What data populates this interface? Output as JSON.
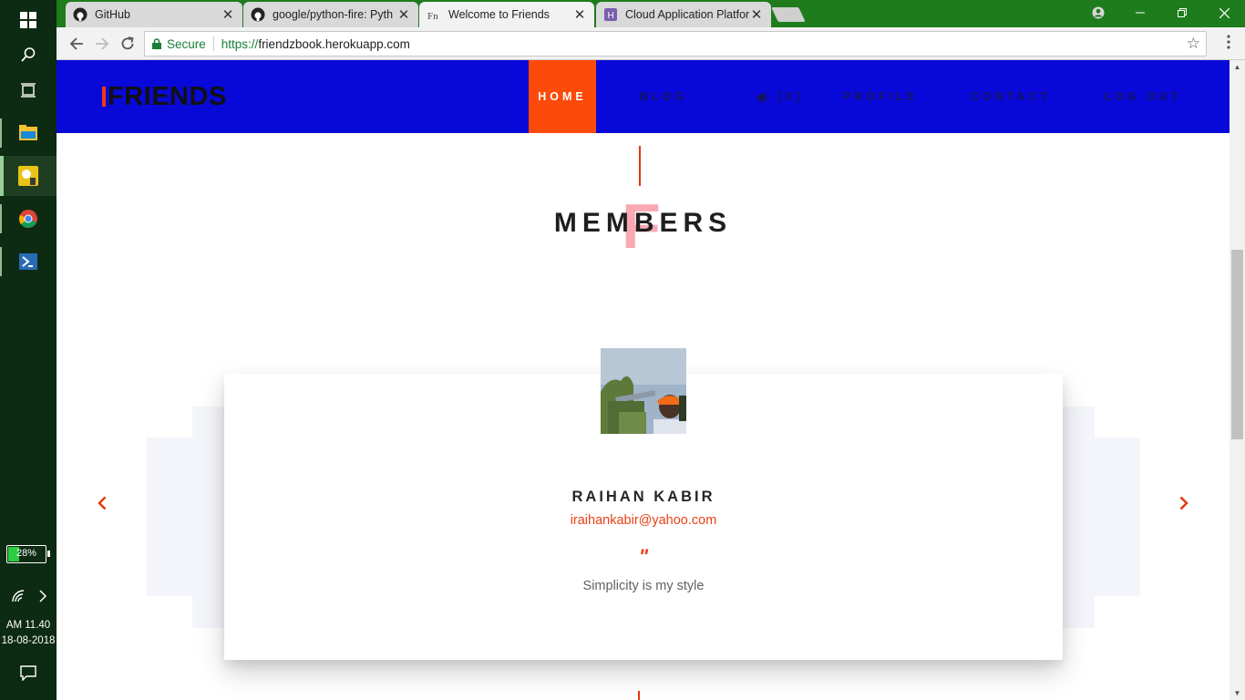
{
  "taskbar": {
    "clock_time": "AM 11.40",
    "clock_date": "18-08-2018",
    "battery_percent": "28%",
    "battery_level": 0.28
  },
  "browser": {
    "tabs": [
      {
        "title": "GitHub",
        "icon": "github-icon"
      },
      {
        "title": "google/python-fire: Pyth",
        "icon": "github-icon"
      },
      {
        "title": "Welcome to Friends",
        "icon": "friends-favicon"
      },
      {
        "title": "Cloud Application Platfor",
        "icon": "heroku-icon"
      }
    ],
    "secure_label": "Secure",
    "url_scheme": "https://",
    "url_host": "friendzbook.herokuapp.com"
  },
  "site": {
    "logo_text": "FRIENDS",
    "nav": [
      {
        "label": "HOME"
      },
      {
        "label": "BLOG"
      },
      {
        "label": "[0]",
        "icon": "megaphone-icon"
      },
      {
        "label": "PROFILE"
      },
      {
        "label": "CONTACT"
      },
      {
        "label": "LOG OUT"
      }
    ],
    "section_letter": "F",
    "section_title": "MEMBERS",
    "member": {
      "name": "RAIHAN KABIR",
      "email": "iraihankabir@yahoo.com",
      "quote_mark": "\"",
      "quote": "Simplicity is my style"
    }
  },
  "colors": {
    "nav_bg": "#0808d8",
    "accent": "#fc4a0a",
    "taskbar_bg": "#0d2a12",
    "tabstrip_bg": "#1e7c1c"
  }
}
